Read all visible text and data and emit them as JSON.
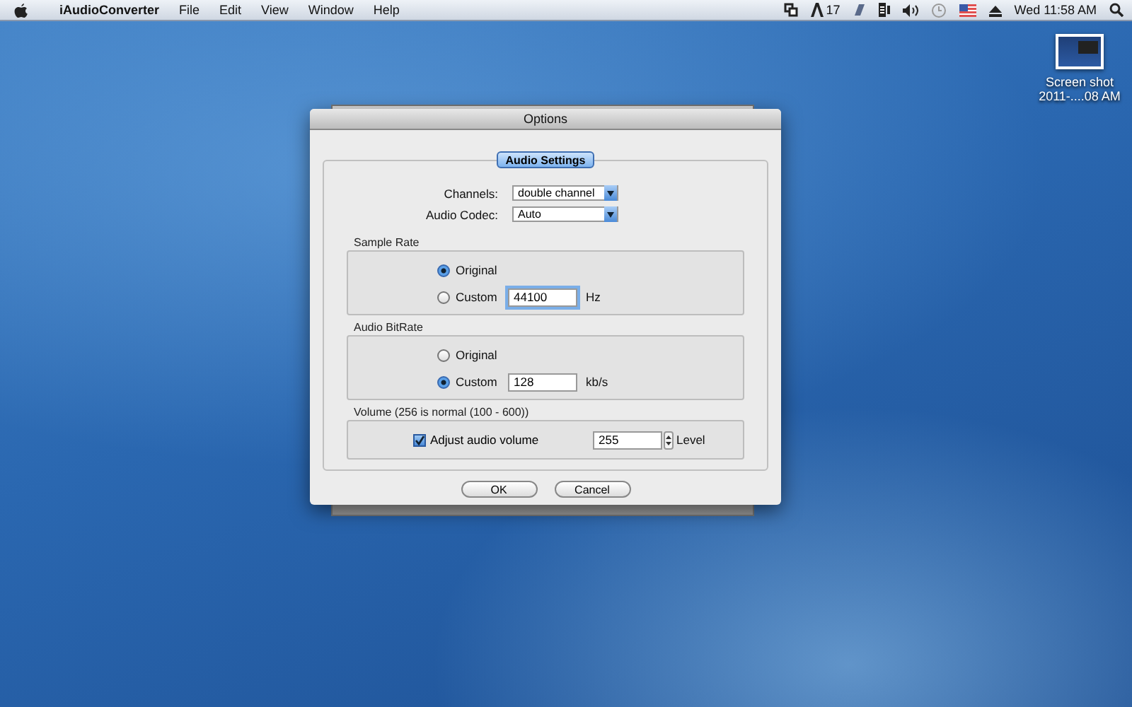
{
  "menubar": {
    "app_name": "iAudioConverter",
    "menus": [
      "File",
      "Edit",
      "View",
      "Window",
      "Help"
    ],
    "status_count": "17",
    "clock": "Wed 11:58 AM"
  },
  "desktop_icons": [
    {
      "label_lines": [
        "Screen shot",
        "2011-....08 AM"
      ]
    }
  ],
  "dialog": {
    "title": "Options",
    "tabs": [
      {
        "label": "Audio Settings",
        "selected": true
      }
    ],
    "dropdowns": [
      {
        "label": "Channels:",
        "value": "double channel"
      },
      {
        "label": "Audio Codec:",
        "value": "Auto"
      }
    ],
    "groups": [
      {
        "title": "Sample Rate",
        "kind": "radio",
        "options": [
          {
            "label": "Original",
            "selected": true
          },
          {
            "label": "Custom",
            "selected": false,
            "value": "44100",
            "unit": "Hz",
            "focused": true
          }
        ]
      },
      {
        "title": "Audio BitRate",
        "kind": "radio",
        "options": [
          {
            "label": "Original",
            "selected": false
          },
          {
            "label": "Custom",
            "selected": true,
            "value": "128",
            "unit": "kb/s",
            "focused": false
          }
        ]
      },
      {
        "title": "Volume (256 is normal (100 - 600))",
        "kind": "volume",
        "checkbox": {
          "label": "Adjust audio volume",
          "checked": true
        },
        "value": "255",
        "unit": "Level"
      }
    ],
    "buttons": [
      "OK",
      "Cancel"
    ]
  }
}
